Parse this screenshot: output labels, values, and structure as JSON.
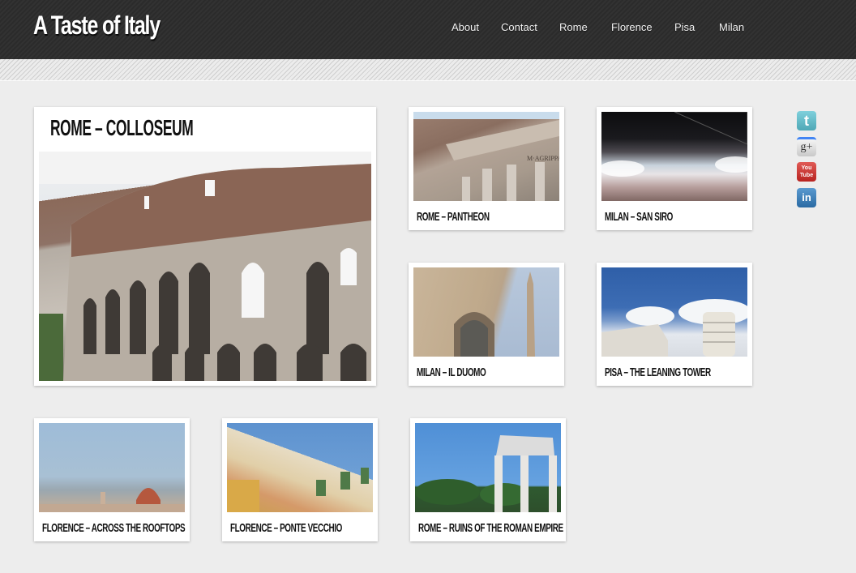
{
  "site": {
    "title": "A Taste of Italy"
  },
  "nav": {
    "items": [
      {
        "label": "About"
      },
      {
        "label": "Contact"
      },
      {
        "label": "Rome"
      },
      {
        "label": "Florence"
      },
      {
        "label": "Pisa"
      },
      {
        "label": "Milan"
      }
    ]
  },
  "featured": {
    "caption": "Rome – Colloseum",
    "image": "colosseum-photo"
  },
  "gallery": [
    {
      "caption": "Rome – Pantheon",
      "image": "pantheon-photo"
    },
    {
      "caption": "Milan – San Siro",
      "image": "san-siro-photo"
    },
    {
      "caption": "Milan – Il Duomo",
      "image": "duomo-milan-photo"
    },
    {
      "caption": "Pisa – The Leaning Tower",
      "image": "leaning-tower-photo"
    },
    {
      "caption": "Florence – Across the Rooftops",
      "image": "florence-rooftops-photo"
    },
    {
      "caption": "Florence – Ponte Vecchio",
      "image": "ponte-vecchio-photo"
    },
    {
      "caption": "Rome – Ruins of the Roman Empire",
      "image": "roman-ruins-photo"
    }
  ],
  "social": [
    {
      "name": "twitter",
      "glyph": "t"
    },
    {
      "name": "google-plus",
      "glyph": "g+"
    },
    {
      "name": "youtube",
      "glyph": "You Tube"
    },
    {
      "name": "linkedin",
      "glyph": "in"
    }
  ],
  "colors": {
    "header_bg": "#2b2b2b",
    "page_bg": "#ededed",
    "card_bg": "#ffffff",
    "caption_text": "#111111",
    "nav_text": "#f2f2f2"
  }
}
